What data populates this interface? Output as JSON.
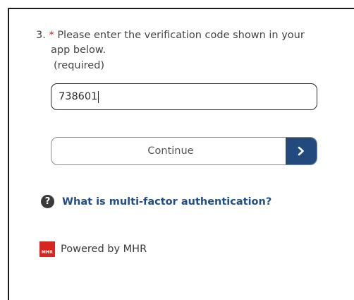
{
  "question": {
    "number": "3.",
    "required_marker": "*",
    "text_line1": "Please enter the verification code shown in your",
    "text_line2": "app below.",
    "required_note": "(required)"
  },
  "code_input": {
    "value": "738601"
  },
  "continue_button": {
    "label": "Continue",
    "arrow_icon": "chevron-right-icon",
    "arrow_color": "#234a7c"
  },
  "help_link": {
    "icon": "question-circle-icon",
    "label": "What is multi-factor authentication?",
    "color": "#1f4f8a"
  },
  "footer": {
    "logo_text": "MHR",
    "logo_color": "#d6261f",
    "powered_by": "Powered by MHR"
  }
}
